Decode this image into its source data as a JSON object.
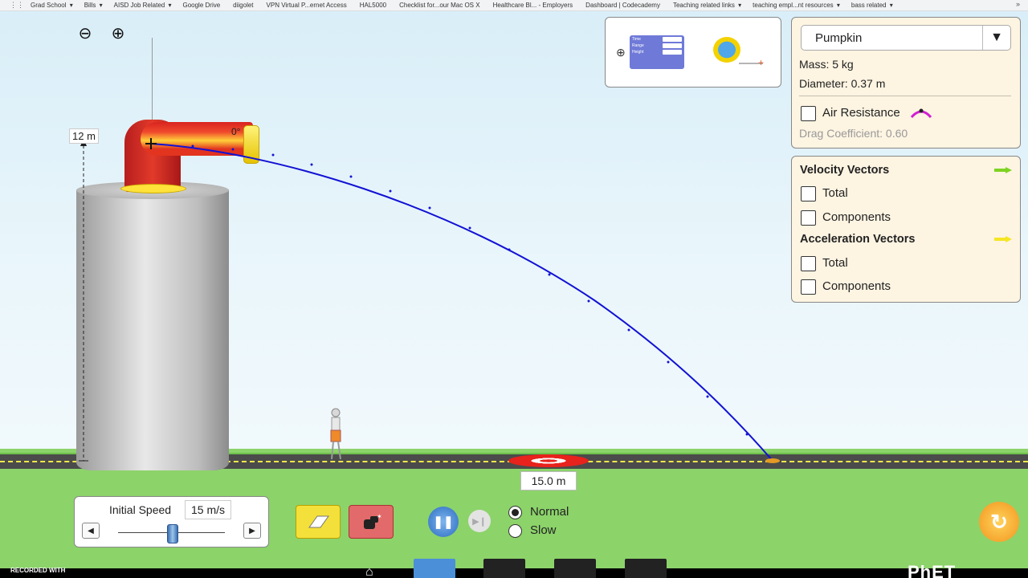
{
  "bookmarks": [
    {
      "label": "Grad School",
      "has_menu": true
    },
    {
      "label": "Bills",
      "has_menu": true
    },
    {
      "label": "AISD Job Related",
      "has_menu": true
    },
    {
      "label": "Google Drive",
      "has_menu": false
    },
    {
      "label": "diigolet",
      "has_menu": false
    },
    {
      "label": "VPN Virtual P...ernet Access",
      "has_menu": false
    },
    {
      "label": "HAL5000",
      "has_menu": false
    },
    {
      "label": "Checklist for...our Mac OS X",
      "has_menu": false
    },
    {
      "label": "Healthcare Bl... - Employers",
      "has_menu": false
    },
    {
      "label": "Dashboard | Codecademy",
      "has_menu": false
    },
    {
      "label": "Teaching related links",
      "has_menu": true
    },
    {
      "label": "teaching empl...nt resources",
      "has_menu": true
    },
    {
      "label": "bass related",
      "has_menu": true
    }
  ],
  "scene": {
    "height_label": "12 m",
    "angle_label": "0°",
    "target_distance": "15.0 m"
  },
  "tools": {
    "stopwatch_rows": [
      "Time",
      "Range",
      "Height"
    ]
  },
  "projectile_panel": {
    "selected": "Pumpkin",
    "mass": "Mass: 5 kg",
    "diameter": "Diameter: 0.37 m",
    "air_resistance_label": "Air Resistance",
    "air_resistance_checked": false,
    "drag_coefficient": "Drag Coefficient: 0.60"
  },
  "vectors_panel": {
    "velocity_heading": "Velocity Vectors",
    "velocity_total": "Total",
    "velocity_components": "Components",
    "acceleration_heading": "Acceleration Vectors",
    "acceleration_total": "Total",
    "acceleration_components": "Components",
    "velocity_color": "#7ed321",
    "acceleration_color": "#f5e623"
  },
  "controls": {
    "initial_speed_label": "Initial Speed",
    "initial_speed_value": "15 m/s",
    "initial_speed_fraction": 0.5,
    "speed_normal": "Normal",
    "speed_slow": "Slow",
    "selected_speed": "Normal"
  },
  "footer": {
    "recorded_with": "RECORDED WITH"
  },
  "colors": {
    "trajectory": "#1212d4",
    "panel_bg": "#fdf4e2",
    "accent_blue": "#2b6cc1"
  }
}
